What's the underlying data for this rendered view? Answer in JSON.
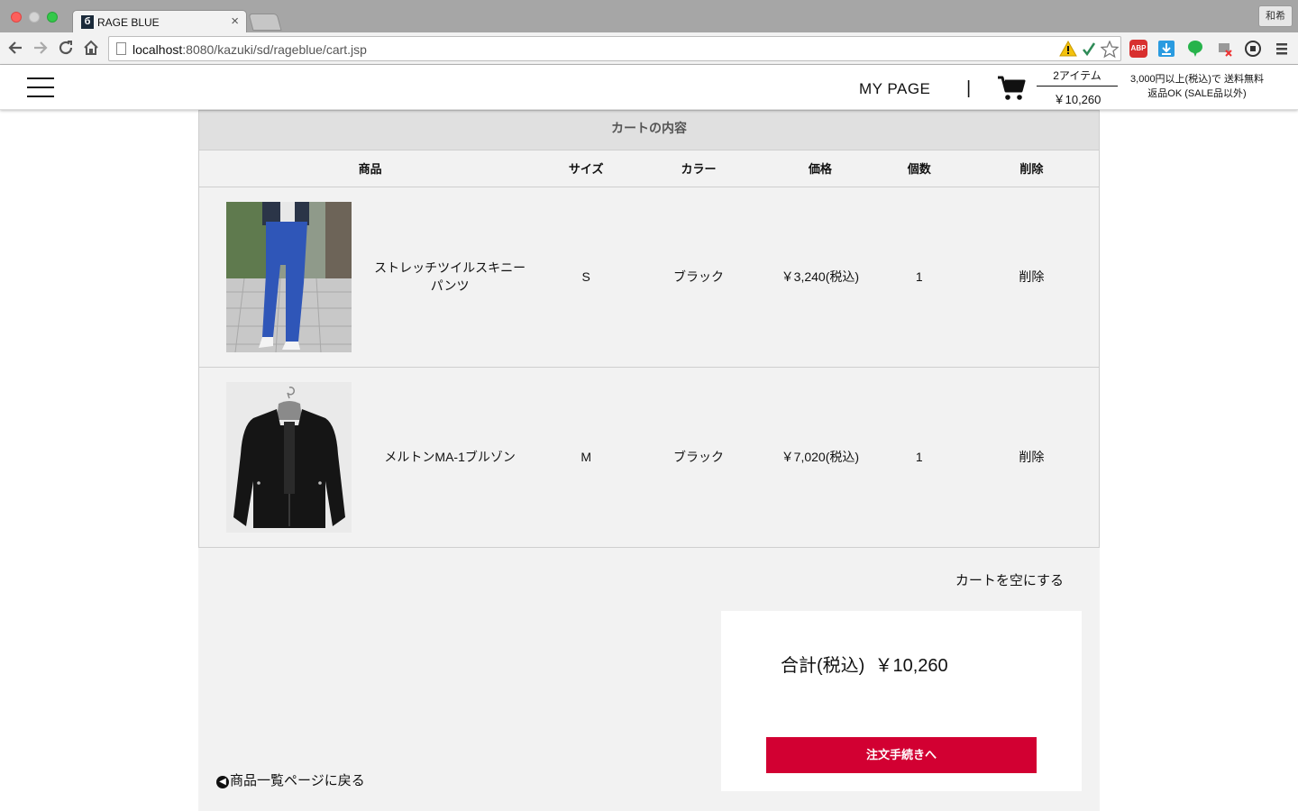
{
  "browser": {
    "tab_title": "RAGE BLUE",
    "tab_favicon": "б",
    "tab_close": "×",
    "profile_name": "和希",
    "url_host": "localhost",
    "url_path": ":8080/kazuki/sd/rageblue/cart.jsp",
    "extensions": [
      "warning-icon",
      "check-icon",
      "star-icon",
      "abp-icon",
      "download-icon",
      "bubble-icon",
      "dropbox-icon",
      "record-icon",
      "menu-icon"
    ],
    "abp_label": "ABP"
  },
  "header": {
    "my_page": "MY PAGE",
    "separator": "|",
    "cart_items": "2アイテム",
    "cart_total": "￥10,260",
    "shipping_line1": "3,000円以上(税込)で 送料無料",
    "shipping_line2": "返品OK (SALE品以外)"
  },
  "cart": {
    "title": "カートの内容",
    "columns": {
      "product": "商品",
      "size": "サイズ",
      "color": "カラー",
      "price": "価格",
      "quantity": "個数",
      "delete": "削除"
    },
    "items": [
      {
        "image": "blue-skinny-pants-photo",
        "name": "ストレッチツイルスキニーパンツ",
        "size": "S",
        "color": "ブラック",
        "price": "￥3,240(税込)",
        "quantity": "1",
        "delete": "削除"
      },
      {
        "image": "black-ma1-jacket-photo",
        "name": "メルトンMA-1ブルゾン",
        "size": "M",
        "color": "ブラック",
        "price": "￥7,020(税込)",
        "quantity": "1",
        "delete": "削除"
      }
    ],
    "empty_cart": "カートを空にする",
    "total_label": "合計(税込)",
    "total_value": "￥10,260",
    "order_button": "注文手続きへ",
    "back_link": "商品一覧ページに戻る"
  },
  "colors": {
    "accent": "#d20032",
    "panel_bg": "#f2f2f2",
    "title_bg": "#e0e0e0"
  }
}
